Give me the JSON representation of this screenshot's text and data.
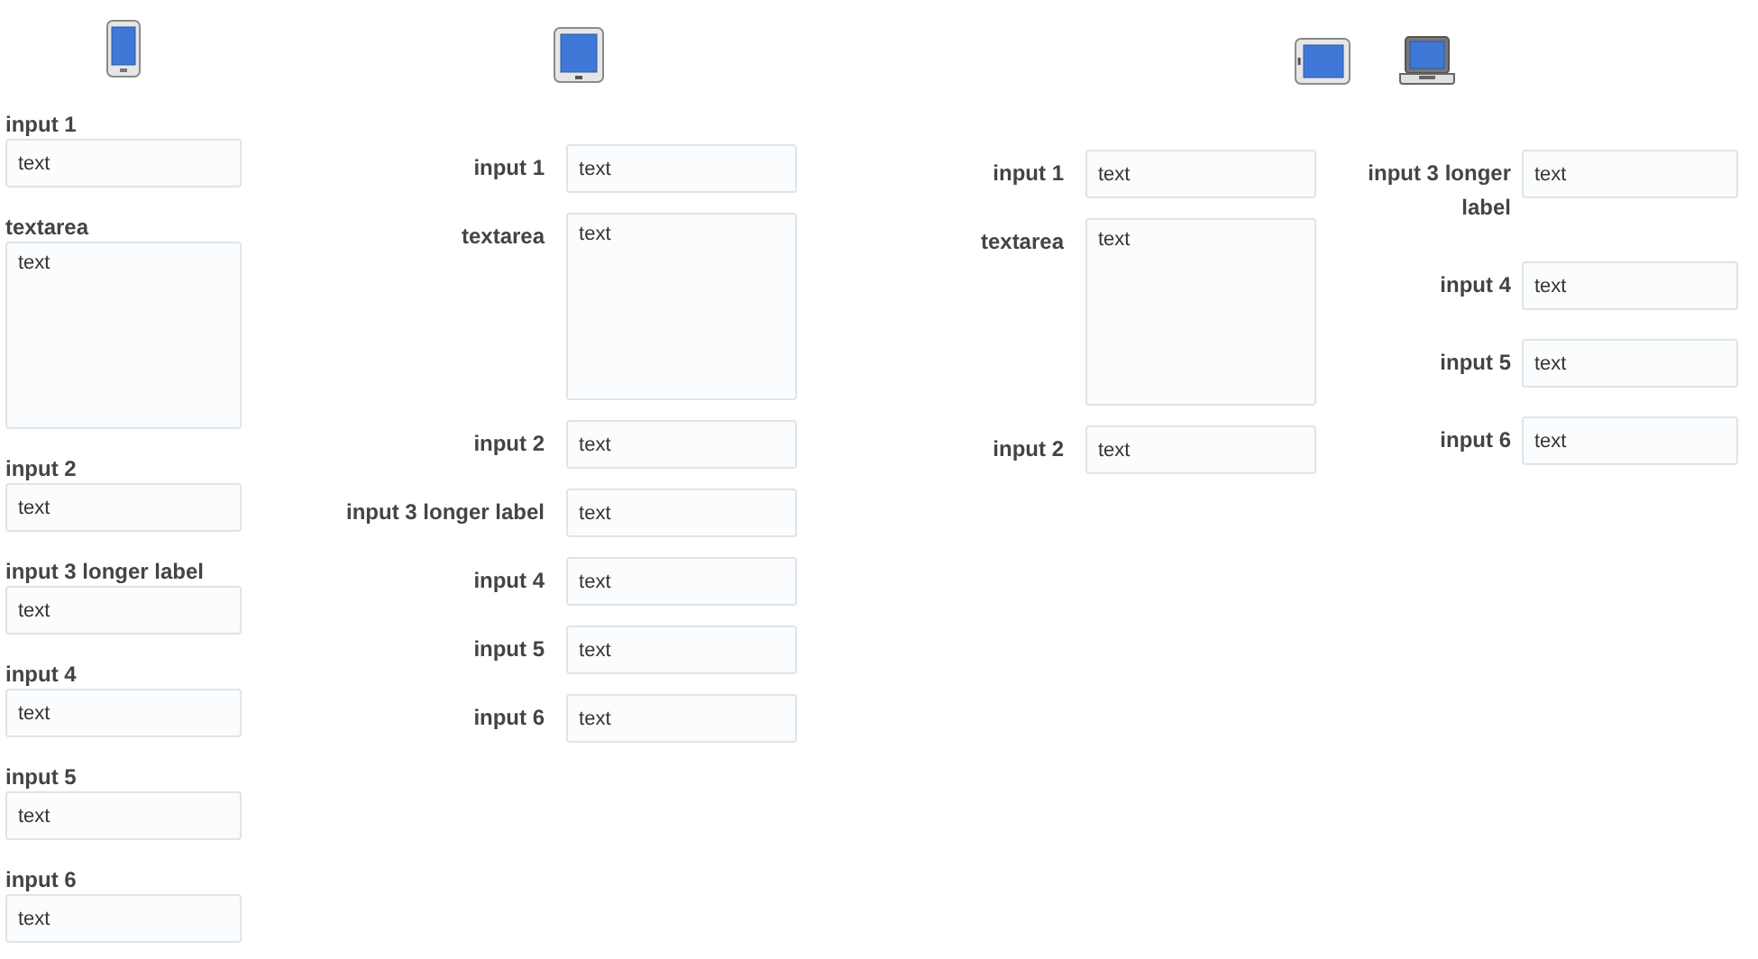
{
  "panels": [
    {
      "kind": "stacked",
      "devices": [
        {
          "kind": "phone"
        }
      ],
      "columns": [
        [
          {
            "kind": "input",
            "label": "input 1",
            "value": "text"
          },
          {
            "kind": "textarea",
            "label": "textarea",
            "value": "text"
          },
          {
            "kind": "input",
            "label": "input 2",
            "value": "text"
          },
          {
            "kind": "input",
            "label": "input 3 longer label",
            "value": "text"
          },
          {
            "kind": "input",
            "label": "input 4",
            "value": "text"
          },
          {
            "kind": "input",
            "label": "input 5",
            "value": "text"
          },
          {
            "kind": "input",
            "label": "input 6",
            "value": "text"
          }
        ]
      ]
    },
    {
      "kind": "inline",
      "devices": [
        {
          "kind": "tablet-portrait"
        }
      ],
      "columns": [
        [
          {
            "kind": "input",
            "label": "input 1",
            "value": "text"
          },
          {
            "kind": "textarea",
            "label": "textarea",
            "value": "text"
          },
          {
            "kind": "input",
            "label": "input 2",
            "value": "text"
          },
          {
            "kind": "input",
            "label": "input 3 longer label",
            "value": "text"
          },
          {
            "kind": "input",
            "label": "input 4",
            "value": "text"
          },
          {
            "kind": "input",
            "label": "input 5",
            "value": "text"
          },
          {
            "kind": "input",
            "label": "input 6",
            "value": "text"
          }
        ]
      ]
    },
    {
      "kind": "columns",
      "devices": [
        {
          "kind": "tablet-landscape"
        },
        {
          "kind": "laptop"
        }
      ],
      "columns": [
        [
          {
            "kind": "input",
            "label": "input 1",
            "value": "text"
          },
          {
            "kind": "textarea",
            "label": "textarea",
            "value": "text"
          },
          {
            "kind": "input",
            "label": "input 2",
            "value": "text"
          }
        ],
        [
          {
            "kind": "input",
            "label": "input 3 longer label",
            "value": "text"
          },
          {
            "kind": "input",
            "label": "input 4",
            "value": "text"
          },
          {
            "kind": "input",
            "label": "input 5",
            "value": "text"
          },
          {
            "kind": "input",
            "label": "input 6",
            "value": "text"
          }
        ]
      ]
    }
  ]
}
